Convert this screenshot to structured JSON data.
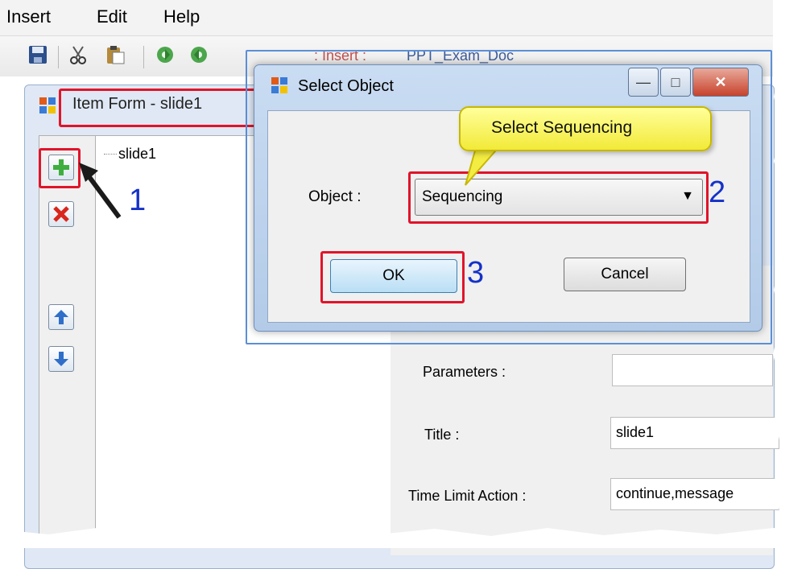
{
  "menu": {
    "items": [
      "Insert",
      "Edit",
      "Help"
    ]
  },
  "toolbar": {
    "insert_label": ": Insert :",
    "doc_label": "PPT_Exam_Doc"
  },
  "item_form": {
    "title": "Item Form  - slide1",
    "tree_item": "slide1",
    "parameters_label": "Parameters :",
    "parameters_value": "",
    "title_label": "Title :",
    "title_value": "slide1",
    "time_limit_label": "Time Limit Action :",
    "time_limit_value": "continue,message"
  },
  "dialog": {
    "title": "Select Object",
    "object_label": "Object :",
    "object_value": "Sequencing",
    "ok_label": "OK",
    "cancel_label": "Cancel"
  },
  "annotations": {
    "callout": "Select Sequencing",
    "step1": "1",
    "step2": "2",
    "step3": "3"
  },
  "colors": {
    "highlight": "#e0142a",
    "step_number": "#1531c8",
    "callout_fill": "#f7f36a"
  },
  "icons": [
    "save-icon",
    "cut-icon",
    "paste-icon",
    "gear-icon",
    "add-icon",
    "delete-icon",
    "move-up-icon",
    "move-down-icon",
    "form-icon"
  ]
}
